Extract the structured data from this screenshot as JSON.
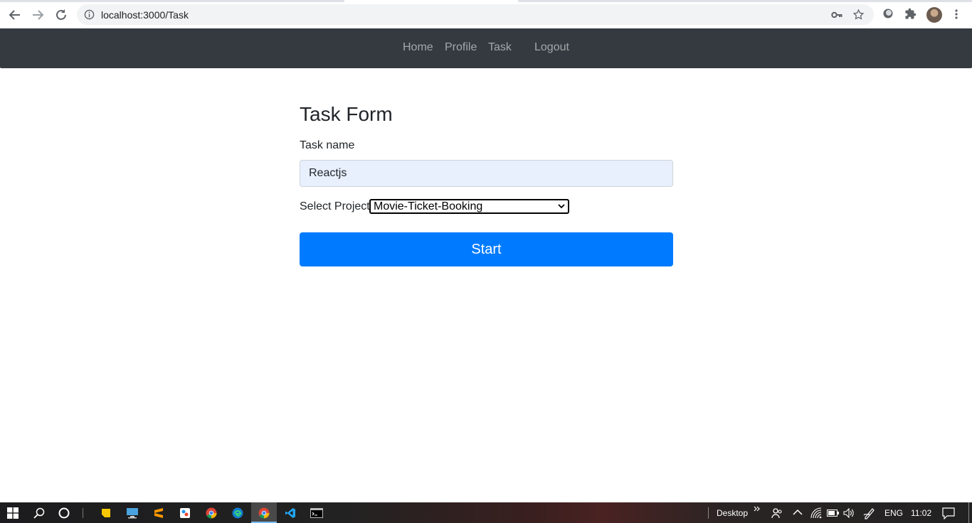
{
  "browser": {
    "url": "localhost:3000/Task"
  },
  "navbar": {
    "links": [
      "Home",
      "Profile",
      "Task",
      "Logout"
    ]
  },
  "form": {
    "title": "Task Form",
    "task_name_label": "Task name",
    "task_name_value": "Reactjs",
    "project_label": "Select Project",
    "project_selected": "Movie-Ticket-Booking",
    "submit_label": "Start"
  },
  "taskbar": {
    "desktop_label": "Desktop",
    "language": "ENG",
    "time": "11:02"
  },
  "colors": {
    "navbar_bg": "#343a40",
    "primary": "#007bff",
    "autofill_bg": "#e8f0fe"
  }
}
